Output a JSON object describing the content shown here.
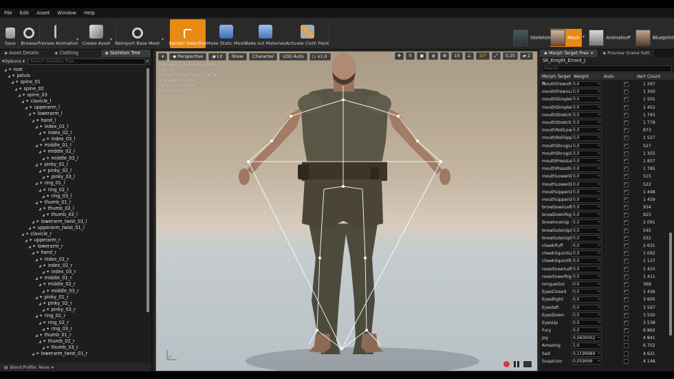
{
  "menu": [
    "File",
    "Edit",
    "Asset",
    "Window",
    "Help"
  ],
  "toolbar": {
    "buttons": [
      {
        "label": "Save"
      },
      {
        "label": "Browse"
      },
      {
        "label": "Preview Animation"
      },
      {
        "label": "Create Asset"
      },
      {
        "label": "Reimport Base Mesh"
      },
      {
        "label": "Section Selection"
      },
      {
        "label": "Make Static Mesh"
      },
      {
        "label": "Bake out Materials"
      },
      {
        "label": "Activate Cloth Paint"
      }
    ],
    "modes": [
      {
        "label": "Skeleton"
      },
      {
        "label": "Mesh"
      },
      {
        "label": "Animation"
      },
      {
        "label": "Blueprint"
      }
    ],
    "accent": "#e98a12"
  },
  "left_panel": {
    "tabs": [
      "Asset Details",
      "Clothing",
      "Skeleton Tree"
    ],
    "options_label": "Options",
    "search_placeholder": "Search Skeleton Tree...",
    "tree": [
      {
        "name": "root",
        "indent": 0
      },
      {
        "name": "pelvis",
        "indent": 1
      },
      {
        "name": "spine_01",
        "indent": 2
      },
      {
        "name": "spine_02",
        "indent": 3
      },
      {
        "name": "spine_03",
        "indent": 4
      },
      {
        "name": "clavicle_l",
        "indent": 5
      },
      {
        "name": "upperarm_l",
        "indent": 6
      },
      {
        "name": "lowerarm_l",
        "indent": 7
      },
      {
        "name": "hand_l",
        "indent": 8
      },
      {
        "name": "index_01_l",
        "indent": 9
      },
      {
        "name": "index_02_l",
        "indent": 10
      },
      {
        "name": "index_03_l",
        "indent": 11
      },
      {
        "name": "middle_01_l",
        "indent": 9
      },
      {
        "name": "middle_02_l",
        "indent": 10
      },
      {
        "name": "middle_03_l",
        "indent": 11
      },
      {
        "name": "pinky_01_l",
        "indent": 9
      },
      {
        "name": "pinky_02_l",
        "indent": 10
      },
      {
        "name": "pinky_03_l",
        "indent": 11
      },
      {
        "name": "ring_01_l",
        "indent": 9
      },
      {
        "name": "ring_02_l",
        "indent": 10
      },
      {
        "name": "ring_03_l",
        "indent": 11
      },
      {
        "name": "thumb_01_l",
        "indent": 9
      },
      {
        "name": "thumb_02_l",
        "indent": 10
      },
      {
        "name": "thumb_03_l",
        "indent": 11
      },
      {
        "name": "lowerarm_twist_01_l",
        "indent": 8
      },
      {
        "name": "upperarm_twist_01_l",
        "indent": 7
      },
      {
        "name": "clavicle_r",
        "indent": 5
      },
      {
        "name": "upperarm_r",
        "indent": 6
      },
      {
        "name": "lowerarm_r",
        "indent": 7
      },
      {
        "name": "hand_r",
        "indent": 8
      },
      {
        "name": "index_01_r",
        "indent": 9
      },
      {
        "name": "index_02_r",
        "indent": 10
      },
      {
        "name": "index_03_r",
        "indent": 11
      },
      {
        "name": "middle_01_r",
        "indent": 9
      },
      {
        "name": "middle_02_r",
        "indent": 10
      },
      {
        "name": "middle_03_r",
        "indent": 11
      },
      {
        "name": "pinky_01_r",
        "indent": 9
      },
      {
        "name": "pinky_02_r",
        "indent": 10
      },
      {
        "name": "pinky_03_r",
        "indent": 11
      },
      {
        "name": "ring_01_r",
        "indent": 9
      },
      {
        "name": "ring_02_r",
        "indent": 10
      },
      {
        "name": "ring_03_r",
        "indent": 11
      },
      {
        "name": "thumb_01_r",
        "indent": 9
      },
      {
        "name": "thumb_02_r",
        "indent": 10
      },
      {
        "name": "thumb_03_r",
        "indent": 11
      },
      {
        "name": "lowerarm_twist_01_r",
        "indent": 8
      }
    ],
    "footer": "Blend Profile: None"
  },
  "viewport": {
    "buttons": [
      "Perspective",
      "Lit",
      "Show",
      "Character",
      "LOD Auto",
      "x1,0"
    ],
    "right_buttons": [
      "10",
      "10°",
      "0,25",
      "2"
    ],
    "info": [
      "Previewing Reference Pose",
      "LOD: 0",
      "Current Screen Size: 3,679",
      "Triangles: 55 403",
      "Vertices: 32 579",
      "UV Channels: 1",
      "Approx Size: 267x93x203"
    ]
  },
  "right_panel": {
    "tabs": [
      "Morph Target Prev",
      "Preview Scene Sett"
    ],
    "mesh_name": "SK_Knight_Errant_J",
    "search_placeholder": "Search",
    "columns": [
      "Morph Target N",
      "Weight",
      "Auto",
      "Vert Count"
    ],
    "rows": [
      {
        "name": "mouthFrownRig",
        "weight": "0,0",
        "auto": true,
        "count": "1 297"
      },
      {
        "name": "mouthFrownLef",
        "weight": "0,0",
        "auto": true,
        "count": "1 300"
      },
      {
        "name": "mouthDimpleLe",
        "weight": "0,0",
        "auto": true,
        "count": "1 501"
      },
      {
        "name": "mouthDimpleRig",
        "weight": "0,0",
        "auto": true,
        "count": "1 452"
      },
      {
        "name": "mouthStretchLe",
        "weight": "0,0",
        "auto": true,
        "count": "1 793"
      },
      {
        "name": "mouthStretchRi",
        "weight": "0,0",
        "auto": true,
        "count": "1 778"
      },
      {
        "name": "mouthRollLowe",
        "weight": "0,0",
        "auto": true,
        "count": "873"
      },
      {
        "name": "mouthRollUppe",
        "weight": "0,0",
        "auto": true,
        "count": "1 527"
      },
      {
        "name": "mouthShrugLow",
        "weight": "0,0",
        "auto": true,
        "count": "527"
      },
      {
        "name": "mouthShrugUpp",
        "weight": "0,0",
        "auto": true,
        "count": "1 355"
      },
      {
        "name": "mouthPressLeft",
        "weight": "0,0",
        "auto": true,
        "count": "1 837"
      },
      {
        "name": "mouthPressRigh",
        "weight": "0,0",
        "auto": true,
        "count": "1 785"
      },
      {
        "name": "mouthLowerDow",
        "weight": "0,0",
        "auto": true,
        "count": "515"
      },
      {
        "name": "mouthLowerDow",
        "weight": "0,0",
        "auto": true,
        "count": "522"
      },
      {
        "name": "mouthUpperUpL",
        "weight": "0,0",
        "auto": true,
        "count": "1 448"
      },
      {
        "name": "mouthUpperUpR",
        "weight": "0,0",
        "auto": true,
        "count": "1 439"
      },
      {
        "name": "browDownLeft",
        "weight": "0,0",
        "auto": true,
        "count": "934"
      },
      {
        "name": "browDownRight",
        "weight": "0,0",
        "auto": true,
        "count": "925"
      },
      {
        "name": "browInnerUp",
        "weight": "0,0",
        "auto": true,
        "count": "1 091"
      },
      {
        "name": "browOuterUpLe",
        "weight": "0,0",
        "auto": true,
        "count": "545"
      },
      {
        "name": "browOuterUpRi",
        "weight": "0,0",
        "auto": true,
        "count": "532"
      },
      {
        "name": "cheekPuff",
        "weight": "0,0",
        "auto": true,
        "count": "2 631"
      },
      {
        "name": "cheekSquintLeft",
        "weight": "0,0",
        "auto": true,
        "count": "1 092"
      },
      {
        "name": "cheekSquintRig",
        "weight": "0,0",
        "auto": true,
        "count": "1 137"
      },
      {
        "name": "noseSneerLeft",
        "weight": "0,0",
        "auto": true,
        "count": "1 415"
      },
      {
        "name": "noseSneerRight",
        "weight": "0,0",
        "auto": true,
        "count": "1 411"
      },
      {
        "name": "tongueOut",
        "weight": "0,0",
        "auto": true,
        "count": "368"
      },
      {
        "name": "EyesClosed",
        "weight": "0,0",
        "auto": true,
        "count": "1 436"
      },
      {
        "name": "EyesRight",
        "weight": "0,0",
        "auto": true,
        "count": "3 605"
      },
      {
        "name": "Eyesleft",
        "weight": "0,0",
        "auto": true,
        "count": "3 597"
      },
      {
        "name": "EyesDown",
        "weight": "0,0",
        "auto": true,
        "count": "3 550"
      },
      {
        "name": "EyesUp",
        "weight": "0,0",
        "auto": true,
        "count": "3 538"
      },
      {
        "name": "Fury",
        "weight": "0,0",
        "auto": true,
        "count": "6 862"
      },
      {
        "name": "Joy",
        "weight": "0,0600002",
        "auto": false,
        "count": "4 841"
      },
      {
        "name": "Amazing",
        "weight": "1,0",
        "auto": false,
        "count": "6 702"
      },
      {
        "name": "Sad",
        "weight": "0,1199989",
        "auto": false,
        "count": "4 621"
      },
      {
        "name": "Suspicion",
        "weight": "0,059999",
        "auto": false,
        "count": "4 148"
      }
    ]
  }
}
